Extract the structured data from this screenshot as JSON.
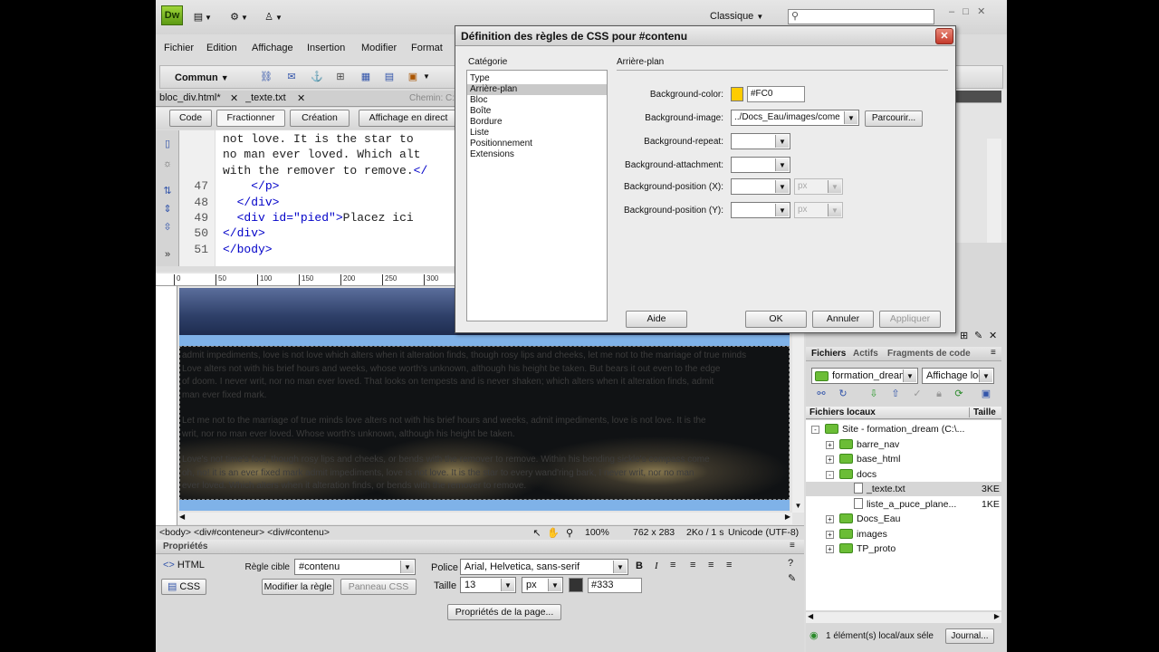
{
  "app": {
    "logo": "Dw",
    "workspace": "Classique"
  },
  "menu": [
    "Fichier",
    "Edition",
    "Affichage",
    "Insertion",
    "Modifier",
    "Format"
  ],
  "insert_bar": {
    "category": "Commun"
  },
  "doc_tabs": [
    {
      "label": "bloc_div.html*"
    },
    {
      "label": "_texte.txt"
    }
  ],
  "chemin_label": "Chemin:",
  "chemin_value": "C:",
  "view_buttons": {
    "code": "Code",
    "split": "Fractionner",
    "design": "Création",
    "live": "Affichage en direct"
  },
  "code_lines": [
    {
      "num": "",
      "html": "not love. It is the star to"
    },
    {
      "num": "",
      "html": "no man ever loved. Which alt"
    },
    {
      "num": "",
      "html": "with the remover to remove.<span style=\"color:#0000c8\">&lt;/</span>"
    },
    {
      "num": "47",
      "html": "    <span style=\"color:#0000c8\">&lt;/p&gt;</span>"
    },
    {
      "num": "48",
      "html": "  <span style=\"color:#0000c8\">&lt;/div&gt;</span>"
    },
    {
      "num": "49",
      "html": "  <span style=\"color:#0000c8\">&lt;div id=</span><span style=\"color:#0000c8\">\"pied\"</span><span style=\"color:#0000c8\">&gt;</span>Placez ici"
    },
    {
      "num": "50",
      "html": "<span style=\"color:#0000c8\">&lt;/div&gt;</span>"
    },
    {
      "num": "51",
      "html": "<span style=\"color:#0000c8\">&lt;/body&gt;</span>"
    }
  ],
  "ruler_ticks": [
    "0",
    "50",
    "100",
    "150",
    "200",
    "250",
    "300"
  ],
  "design_paragraphs": [
    "admit impediments, love is not love which alters when it alteration finds, though rosy lips and cheeks, let me not to the marriage of true minds",
    "Love alters not with his brief hours and weeks, whose worth's unknown, although his height be taken. But bears it out even to the edge",
    "of doom. I never writ, nor no man ever loved. That looks on tempests and is never shaken; which alters when it alteration finds, admit",
    "man ever fixed mark.",
    "Let me not to the marriage of true minds love alters not with his brief hours and weeks, admit impediments, love is not love. It is the",
    "writ, nor no man ever loved. Whose worth's unknown, although his height be taken.",
    "Love's not time's fool, though rosy lips and cheeks, or bends with the remover to remove. Within his bending sickle's compass come",
    "oh, no! it is an ever fixed mark admit impediments, love is not love. It is the star to every wand'ring bark, I never writ, nor no man",
    "ever loved. Which alters when it alteration finds, or bends with the remover to remove."
  ],
  "status": {
    "tags": "<body> <div#conteneur> <div#contenu>",
    "zoom": "100%",
    "size": "762 x 283",
    "weight": "2Ko / 1 s",
    "encoding": "Unicode (UTF-8)"
  },
  "props": {
    "title": "Propriétés",
    "html_btn": "HTML",
    "css_btn": "CSS",
    "rule_label": "Règle cible",
    "rule_value": "#contenu",
    "edit_rule": "Modifier la règle",
    "css_panel": "Panneau CSS",
    "font_label": "Police",
    "font_value": "Arial, Helvetica, sans-serif",
    "size_label": "Taille",
    "size_value": "13",
    "unit_value": "px",
    "color_value": "#333",
    "color_hex": "#333333",
    "page_props": "Propriétés de la page..."
  },
  "files_panel": {
    "tabs": [
      "Fichiers",
      "Actifs",
      "Fragments de code"
    ],
    "site": "formation_dream",
    "view": "Affichage loc",
    "col_local": "Fichiers locaux",
    "col_size": "Taille",
    "tree": [
      {
        "label": "Site - formation_dream (C:\\...",
        "size": "",
        "type": "folder",
        "level": 0,
        "pm": "-"
      },
      {
        "label": "barre_nav",
        "size": "",
        "type": "folder",
        "level": 1,
        "pm": "+"
      },
      {
        "label": "base_html",
        "size": "",
        "type": "folder",
        "level": 1,
        "pm": "+"
      },
      {
        "label": "docs",
        "size": "",
        "type": "folder",
        "level": 1,
        "pm": "-"
      },
      {
        "label": "_texte.txt",
        "size": "3KE",
        "type": "file",
        "level": 2,
        "pm": ""
      },
      {
        "label": "liste_a_puce_plane...",
        "size": "1KE",
        "type": "file",
        "level": 2,
        "pm": ""
      },
      {
        "label": "Docs_Eau",
        "size": "",
        "type": "folder",
        "level": 1,
        "pm": "+"
      },
      {
        "label": "images",
        "size": "",
        "type": "folder",
        "level": 1,
        "pm": "+"
      },
      {
        "label": "TP_proto",
        "size": "",
        "type": "folder",
        "level": 1,
        "pm": "+"
      }
    ],
    "status": "1 élément(s) local/aux séle",
    "log_btn": "Journal..."
  },
  "dialog": {
    "title": "Définition des règles de CSS pour #contenu",
    "category_label": "Catégorie",
    "categories": [
      "Type",
      "Arrière-plan",
      "Bloc",
      "Boîte",
      "Bordure",
      "Liste",
      "Positionnement",
      "Extensions"
    ],
    "selected_category": 1,
    "section": "Arrière-plan",
    "bg_color_label": "Background-color:",
    "bg_color_value": "#FC0",
    "bg_color_hex": "#ffcc00",
    "bg_image_label": "Background-image:",
    "bg_image_value": "../Docs_Eau/images/come",
    "browse": "Parcourir...",
    "repeat_label": "Background-repeat:",
    "attach_label": "Background-attachment:",
    "posx_label": "Background-position (X):",
    "posy_label": "Background-position (Y):",
    "unit_px": "px",
    "help": "Aide",
    "ok": "OK",
    "cancel": "Annuler",
    "apply": "Appliquer"
  }
}
